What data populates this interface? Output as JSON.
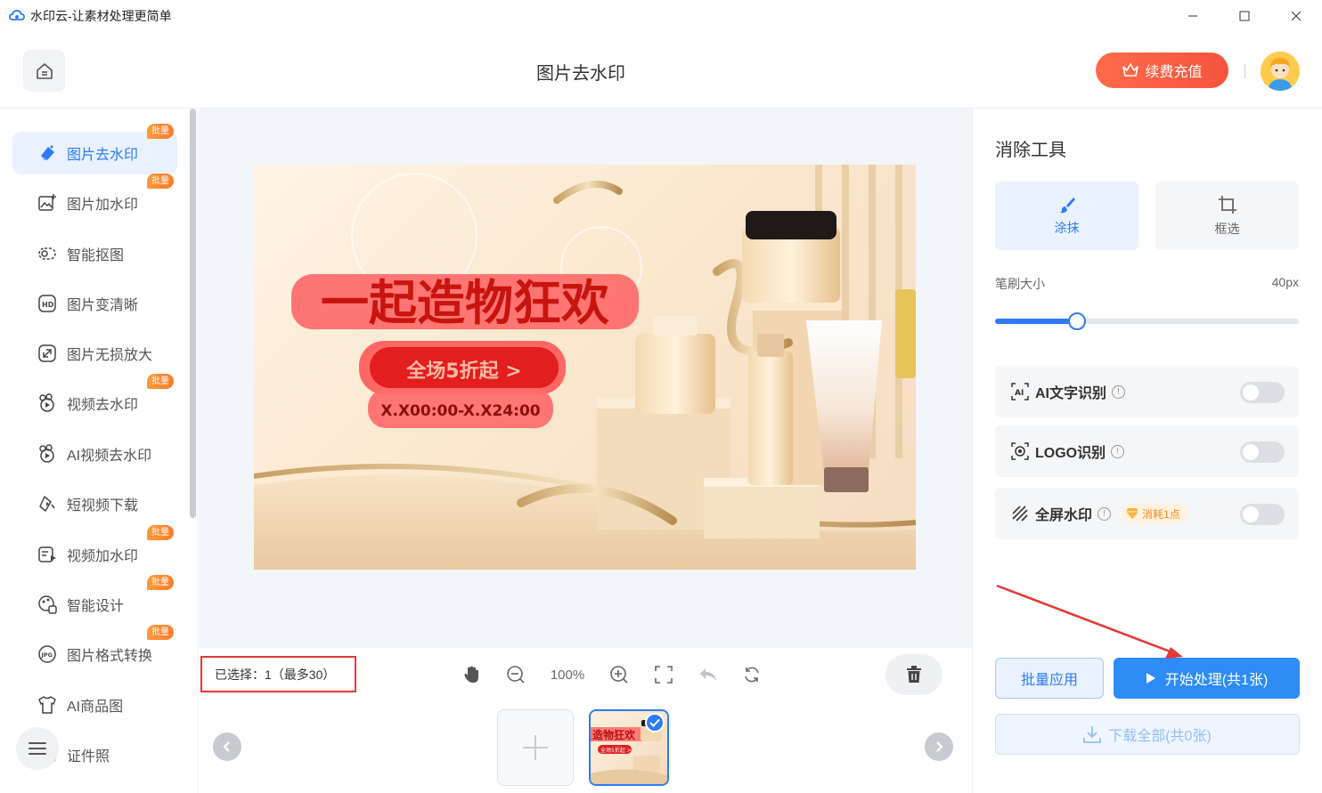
{
  "window": {
    "title": "水印云-让素材处理更简单"
  },
  "header": {
    "page_title": "图片去水印",
    "recharge_label": "续费充值"
  },
  "sidebar": {
    "items": [
      {
        "label": "图片去水印",
        "badge": "批量",
        "icon": "eraser-icon",
        "active": true
      },
      {
        "label": "图片加水印",
        "badge": "批量",
        "icon": "image-add-icon"
      },
      {
        "label": "智能抠图",
        "badge": "",
        "icon": "cutout-icon"
      },
      {
        "label": "图片变清晰",
        "badge": "",
        "icon": "hd-icon"
      },
      {
        "label": "图片无损放大",
        "badge": "",
        "icon": "enlarge-icon"
      },
      {
        "label": "视频去水印",
        "badge": "批量",
        "icon": "video-eraser-icon"
      },
      {
        "label": "AI视频去水印",
        "badge": "",
        "icon": "ai-video-icon"
      },
      {
        "label": "短视频下载",
        "badge": "",
        "icon": "download-video-icon"
      },
      {
        "label": "视频加水印",
        "badge": "批量",
        "icon": "video-add-icon"
      },
      {
        "label": "智能设计",
        "badge": "批量",
        "icon": "design-icon"
      },
      {
        "label": "图片格式转换",
        "badge": "批量",
        "icon": "jpg-icon"
      },
      {
        "label": "AI商品图",
        "badge": "",
        "icon": "shirt-icon"
      },
      {
        "label": "证件照",
        "badge": "",
        "icon": "id-photo-icon"
      }
    ]
  },
  "canvas": {
    "image": {
      "headline": "一起造物狂欢",
      "button_text": "全场5折起 >",
      "time_text": "X.X00:00-X.X24:00"
    }
  },
  "toolbar": {
    "selected_text": "已选择：1（最多30）",
    "zoom": "100%"
  },
  "thumbs": {
    "mini_headline": "造物狂欢",
    "mini_sub": "全场5折起 >"
  },
  "right_panel": {
    "title": "消除工具",
    "modes": [
      {
        "label": "涂抹",
        "icon": "brush-icon",
        "active": true
      },
      {
        "label": "框选",
        "icon": "crop-icon",
        "active": false
      }
    ],
    "brush_label": "笔刷大小",
    "brush_value": "40px",
    "brush_level": 0.27,
    "options": [
      {
        "label": "AI文字识别",
        "icon": "ai-text-icon",
        "info": "!"
      },
      {
        "label": "LOGO识别",
        "icon": "logo-icon",
        "info": "!"
      },
      {
        "label": "全屏水印",
        "icon": "fullscreen-watermark-icon",
        "info": "!",
        "cost": "消耗1点"
      }
    ],
    "batch_label": "批量应用",
    "start_label": "开始处理(共1张)",
    "download_label": "下载全部(共0张)"
  },
  "colors": {
    "accent": "#2d7cf6",
    "recharge": "#f6543d",
    "badge": "#ff8a2c",
    "highlight_box": "#e53935"
  }
}
